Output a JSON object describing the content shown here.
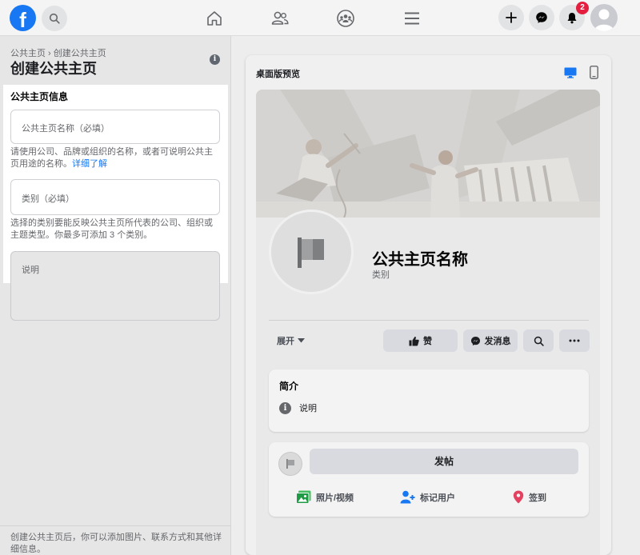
{
  "topbar": {
    "logo_letter": "f",
    "notification_count": "2"
  },
  "left_panel": {
    "breadcrumb": "公共主页 › 创建公共主页",
    "title": "创建公共主页",
    "info_letter": "i",
    "section_title": "公共主页信息",
    "name_field": {
      "placeholder": "公共主页名称（必填）"
    },
    "name_helper": "请使用公司、品牌或组织的名称，或者可说明公共主页用途的名称。",
    "name_helper_link": "详细了解",
    "category_field": {
      "placeholder": "类别（必填）"
    },
    "category_helper": "选择的类别要能反映公共主页所代表的公司、组织或主题类型。你最多可添加 3 个类别。",
    "description_field": {
      "placeholder": "说明"
    },
    "bottom_note": "创建公共主页后，你可以添加图片、联系方式和其他详细信息。"
  },
  "preview": {
    "title": "桌面版预览",
    "page_name": "公共主页名称",
    "page_category": "类别",
    "expand_label": "展开",
    "like_label": "赞",
    "message_label": "发消息",
    "about_title": "简介",
    "about_info_letter": "i",
    "about_description": "说明",
    "post_label": "发帖",
    "photo_video_label": "照片/视频",
    "tag_users_label": "标记用户",
    "checkin_label": "签到"
  },
  "colors": {
    "brand_blue": "#1877f2",
    "badge_red": "#e41e3f",
    "link_blue": "#1877f2"
  }
}
